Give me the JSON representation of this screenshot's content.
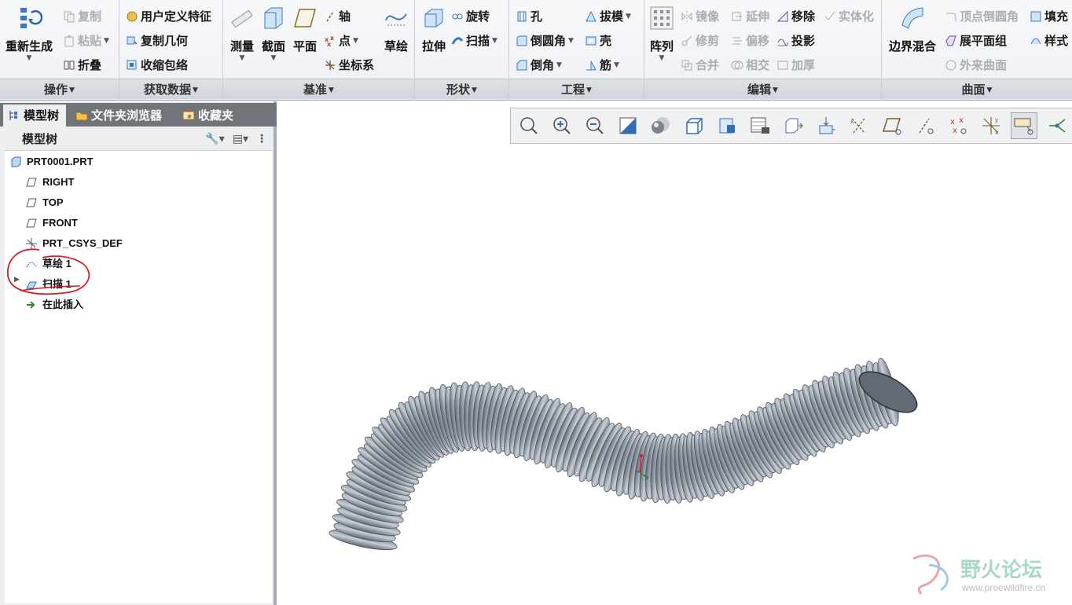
{
  "ribbon": {
    "groups": {
      "operations": {
        "label": "操作",
        "regenerate": "重新生成",
        "copy": "复制",
        "paste": "粘贴",
        "fold": "折叠"
      },
      "get_data": {
        "label": "获取数据",
        "udf": "用户定义特征",
        "copy_geom": "复制几何",
        "shrinkwrap": "收缩包络"
      },
      "datum": {
        "label": "基准",
        "measure": "测量",
        "section": "截面",
        "plane": "平面",
        "axis": "轴",
        "point": "点",
        "csys": "坐标系",
        "sketch": "草绘"
      },
      "shapes": {
        "label": "形状",
        "extrude": "拉伸",
        "revolve": "旋转",
        "sweep": "扫描"
      },
      "engineering": {
        "label": "工程",
        "hole": "孔",
        "round": "倒圆角",
        "chamfer": "倒角",
        "draft": "拔模",
        "shell": "壳",
        "rib": "筋"
      },
      "editing": {
        "label": "编辑",
        "pattern": "阵列",
        "mirror": "镜像",
        "trim": "修剪",
        "merge": "合并",
        "extend": "延伸",
        "offset": "偏移",
        "intersect": "相交",
        "move": "移除",
        "project": "投影",
        "thicken": "加厚",
        "solidify": "实体化"
      },
      "surfaces": {
        "label": "曲面",
        "boundary_blend": "边界混合",
        "vertex_round": "顶点倒圆角",
        "flatten_quilt": "展平面组",
        "freestyle": "外来曲面",
        "fill": "填充",
        "style": "样式"
      }
    }
  },
  "panel": {
    "tabs": [
      "模型树",
      "文件夹浏览器",
      "收藏夹"
    ],
    "tree_title": "模型树",
    "tree": [
      "PRT0001.PRT",
      "RIGHT",
      "TOP",
      "FRONT",
      "PRT_CSYS_DEF",
      "草绘 1",
      "扫描 1",
      "在此插入"
    ]
  },
  "watermark": {
    "title": "野火论坛",
    "url": "www.proewildfire.cn"
  },
  "colors": {
    "accent": "#2f6db5",
    "annotation": "#d0202a",
    "model": "#9aa3b0"
  }
}
